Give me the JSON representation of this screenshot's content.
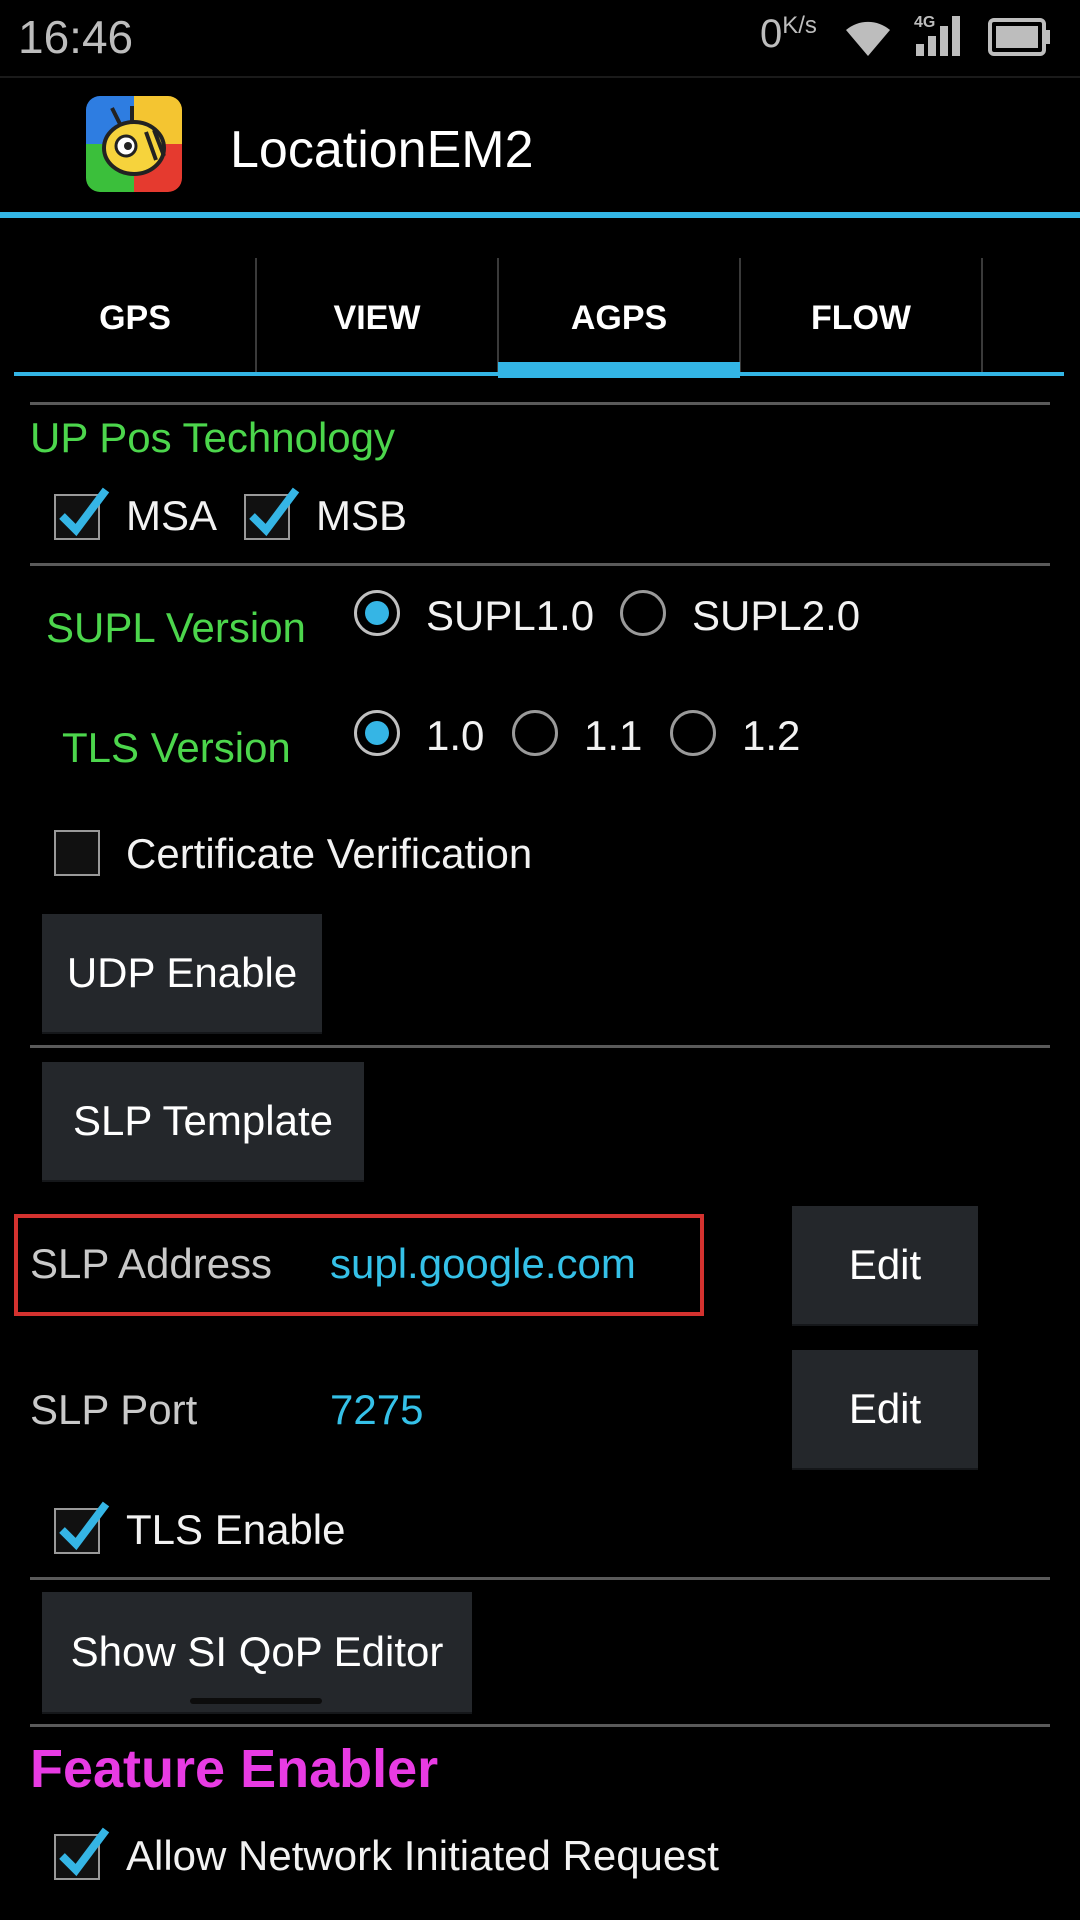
{
  "colors": {
    "accent": "#33b5e5",
    "green": "#4cd64c",
    "magenta": "#e83be3",
    "highlight": "#d4322f"
  },
  "status_bar": {
    "time": "16:46",
    "speed": "0",
    "speed_unit": "K/s",
    "network": "4G"
  },
  "app": {
    "title": "LocationEM2",
    "icon": "bee-app-icon"
  },
  "tabs": [
    {
      "label": "GPS"
    },
    {
      "label": "VIEW"
    },
    {
      "label": "AGPS",
      "active": true
    },
    {
      "label": "FLOW"
    }
  ],
  "up_pos": {
    "heading": "UP Pos Technology",
    "options": [
      {
        "label": "MSA",
        "checked": true
      },
      {
        "label": "MSB",
        "checked": true
      }
    ]
  },
  "supl_version": {
    "label": "SUPL Version",
    "options": [
      {
        "label": "SUPL1.0",
        "selected": true
      },
      {
        "label": "SUPL2.0",
        "selected": false
      }
    ]
  },
  "tls_version": {
    "label": "TLS Version",
    "options": [
      {
        "label": "1.0",
        "selected": true
      },
      {
        "label": "1.1",
        "selected": false
      },
      {
        "label": "1.2",
        "selected": false
      }
    ]
  },
  "certificate_verification": {
    "label": "Certificate Verification",
    "checked": false
  },
  "udp_button": "UDP Enable",
  "slp_template_button": "SLP Template",
  "slp_address": {
    "label": "SLP Address",
    "value": "supl.google.com",
    "edit_label": "Edit"
  },
  "slp_port": {
    "label": "SLP Port",
    "value": "7275",
    "edit_label": "Edit"
  },
  "tls_enable": {
    "label": "TLS Enable",
    "checked": true
  },
  "qop_button": "Show SI QoP Editor",
  "feature_enabler": {
    "heading": "Feature Enabler",
    "allow_ni": {
      "label": "Allow Network Initiated Request",
      "checked": true
    }
  }
}
